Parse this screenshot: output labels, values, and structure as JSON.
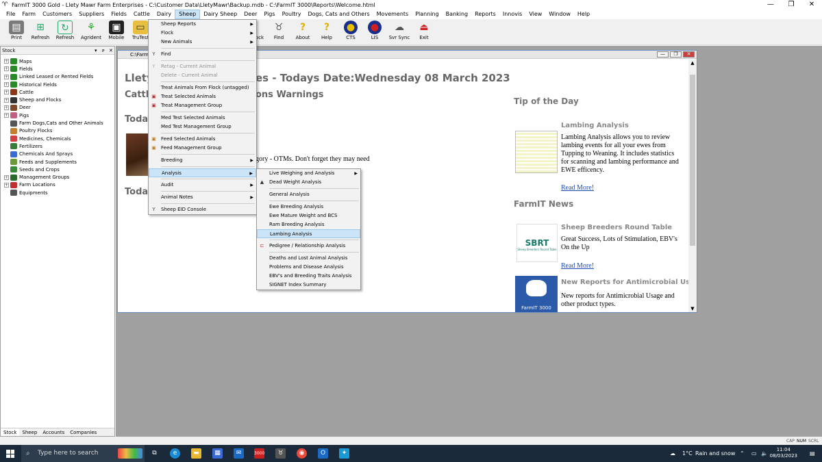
{
  "window": {
    "title": "FarmIT 3000 Gold - Llety Mawr Farm Enterprises - C:\\Customer Data\\LletyMawr\\Backup.mdb - C:\\FarmIT 3000\\Reports\\Welcome.html",
    "minimize": "—",
    "maximize": "❐",
    "close": "✕"
  },
  "menubar": [
    "File",
    "Farm",
    "Customers",
    "Suppliers",
    "Fields",
    "Cattle",
    "Dairy",
    "Sheep",
    "Dairy Sheep",
    "Deer",
    "Pigs",
    "Poultry",
    "Dogs, Cats and Others",
    "Movements",
    "Planning",
    "Banking",
    "Reports",
    "Innovis",
    "View",
    "Window",
    "Help"
  ],
  "toolbar": {
    "print": "Print",
    "refresh1": "Refresh",
    "refresh2": "Refresh",
    "agrident": "Agrident",
    "mobile": "Mobile",
    "trutest": "TruTest",
    "stock": "ock",
    "find": "Find",
    "about": "About",
    "help": "Help",
    "cts": "CTS",
    "lis": "LIS",
    "svrsync": "Svr Sync",
    "exit": "Exit"
  },
  "stock_panel": {
    "title": "Stock",
    "pin": "▾",
    "float": "ᴘ",
    "close": "✕",
    "tree": [
      {
        "label": "Maps",
        "exp": true
      },
      {
        "label": "Fields",
        "exp": true
      },
      {
        "label": "Linked Leased or Rented Fields",
        "exp": true
      },
      {
        "label": "Historical Fields",
        "exp": true
      },
      {
        "label": "Cattle",
        "exp": true
      },
      {
        "label": "Sheep and Flocks",
        "exp": true
      },
      {
        "label": "Deer",
        "exp": true
      },
      {
        "label": "Pigs",
        "exp": true
      },
      {
        "label": "Farm Dogs,Cats and Other Animals",
        "exp": false
      },
      {
        "label": "Poultry Flocks",
        "exp": false
      },
      {
        "label": "Medicines, Chemicals",
        "exp": false
      },
      {
        "label": "Fertilizers",
        "exp": false
      },
      {
        "label": "Chemicals And Sprays",
        "exp": false
      },
      {
        "label": "Feeds and Supplements",
        "exp": false
      },
      {
        "label": "Seeds and Crops",
        "exp": false
      },
      {
        "label": "Management Groups",
        "exp": true
      },
      {
        "label": "Farm Locations",
        "exp": true
      },
      {
        "label": "Equipments",
        "exp": false
      }
    ],
    "tabs": [
      "Stock",
      "Sheep",
      "Accounts",
      "Companies"
    ]
  },
  "document": {
    "title": "C:\\Farm",
    "heading_left": "Llety",
    "heading_right": "es - Todays Date:Wednesday 08 March 2023",
    "cattle_left": "Cattle",
    "cattle_right": "ons Warnings",
    "today1": "Today",
    "today2": "Today",
    "body_text": "gory - OTMs. Don't forget they may need",
    "tip_title": "Tip of the Day",
    "tip_heading": "Lambing Analysis",
    "tip_text": "Lambing Analysis allows you to review lambing events for all your ewes from Tupping to Weaning. It includes statistics for scanning and lambing performance and EWE efficency.",
    "read_more1": "Read More!",
    "news_title": "FarmIT News",
    "news1_heading": "Sheep Breeders Round Table",
    "news1_text": "Great Success, Lots of Stimulation, EBV's On the Up",
    "read_more2": "Read More!",
    "news2_heading": "New Reports for Antimicrobial Usage",
    "news2_text": "New reports for Antimicrobial Usage and other product types.",
    "sbrt_logo": "SBRT",
    "sbrt_sub": "Sheep Breeders Round Table",
    "farmit_logo": "FarmIT 3000"
  },
  "sheep_menu": [
    {
      "label": "Sheep Reports",
      "arrow": true
    },
    {
      "label": "Flock",
      "arrow": true
    },
    {
      "label": "New Animals",
      "arrow": true
    },
    {
      "sep": true
    },
    {
      "label": "Find",
      "icon": "find"
    },
    {
      "sep": true
    },
    {
      "label": "Retag - Current Animal",
      "disabled": true,
      "icon": "retag"
    },
    {
      "label": "Delete - Current Animal",
      "disabled": true
    },
    {
      "sep": true
    },
    {
      "label": "Treat Animals From Flock (untagged)"
    },
    {
      "label": "Treat Selected Animals",
      "icon": "treat"
    },
    {
      "label": "Treat Management Group",
      "icon": "treat"
    },
    {
      "sep": true
    },
    {
      "label": "Med Test Selected Animals"
    },
    {
      "label": "Med Test Management Group"
    },
    {
      "sep": true
    },
    {
      "label": "Feed Selected Animals",
      "icon": "feed"
    },
    {
      "label": "Feed Management Group",
      "icon": "feed"
    },
    {
      "sep": true
    },
    {
      "label": "Breeding",
      "arrow": true
    },
    {
      "sep": true
    },
    {
      "label": "Analysis",
      "arrow": true,
      "highlight": true
    },
    {
      "sep": true
    },
    {
      "label": "Audit",
      "arrow": true
    },
    {
      "sep": true
    },
    {
      "label": "Animal Notes",
      "arrow": true
    },
    {
      "sep": true
    },
    {
      "label": "Sheep EID Console",
      "icon": "find"
    }
  ],
  "analysis_menu": [
    {
      "label": "Live Weighing and Analysis",
      "arrow": true
    },
    {
      "label": "Dead Weight Analysis",
      "icon": "weight"
    },
    {
      "sep": true
    },
    {
      "label": "General Analysis"
    },
    {
      "sep": true
    },
    {
      "label": "Ewe Breeding Analysis"
    },
    {
      "label": "Ewe Mature Weight and BCS"
    },
    {
      "label": "Ram Breeding Analysis"
    },
    {
      "label": "Lambing Analysis",
      "highlight": true
    },
    {
      "sep": true
    },
    {
      "label": "Pedigree / Relationship Analysis",
      "icon": "pedigree"
    },
    {
      "sep": true
    },
    {
      "label": "Deaths and Lost Animal Analysis"
    },
    {
      "label": "Problems and Disease Analysis"
    },
    {
      "label": "EBV's and Breeding Traits Analysis"
    },
    {
      "label": "SIGNET Index Summary"
    }
  ],
  "statusbar": {
    "cap": "CAP",
    "num": "NUM",
    "scrl": "SCRL"
  },
  "taskbar": {
    "search_placeholder": "Type here to search",
    "weather_temp": "1°C",
    "weather_text": "Rain and snow",
    "time": "11:04",
    "date": "08/03/2023"
  }
}
